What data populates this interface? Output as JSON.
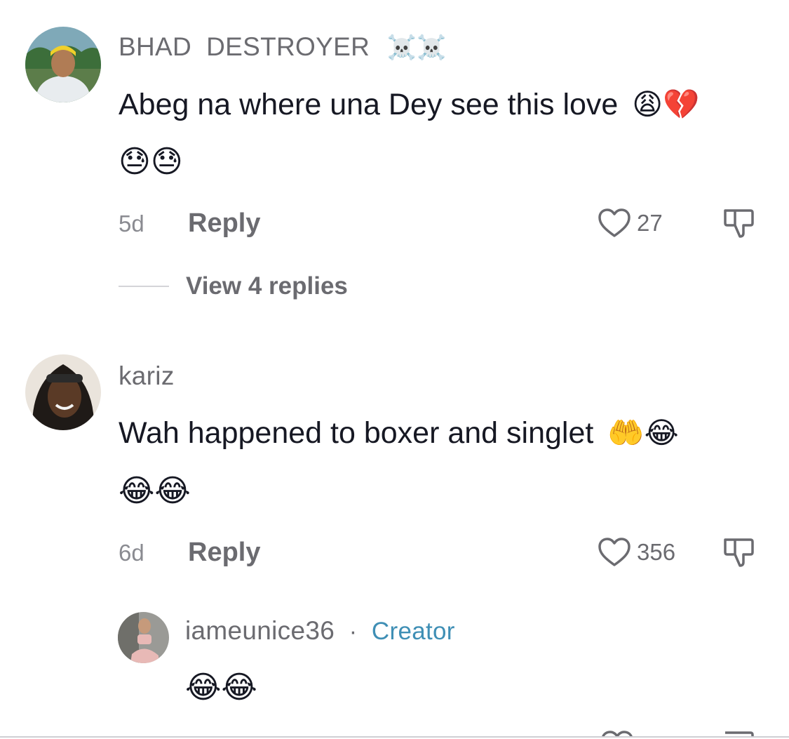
{
  "comments": [
    {
      "username": "BHAD  DESTROYER",
      "username_emoji": "☠️☠️",
      "text": "Abeg na where una Dey see this love",
      "text_emoji": "😩💔",
      "emoji_line": "😓😓",
      "time": "5d",
      "reply_label": "Reply",
      "likes": "27",
      "view_replies": "View 4 replies"
    },
    {
      "username": "kariz",
      "text": "Wah happened to boxer and singlet",
      "text_emoji": "🤲😂",
      "emoji_line": "😂😂",
      "time": "6d",
      "reply_label": "Reply",
      "likes": "356"
    }
  ],
  "reply": {
    "username": "iameunice36",
    "separator": "·",
    "badge": "Creator",
    "emoji_line": "😂😂"
  },
  "colors": {
    "text": "#161823",
    "muted": "#6b6b70",
    "creator": "#3f8fb5"
  }
}
